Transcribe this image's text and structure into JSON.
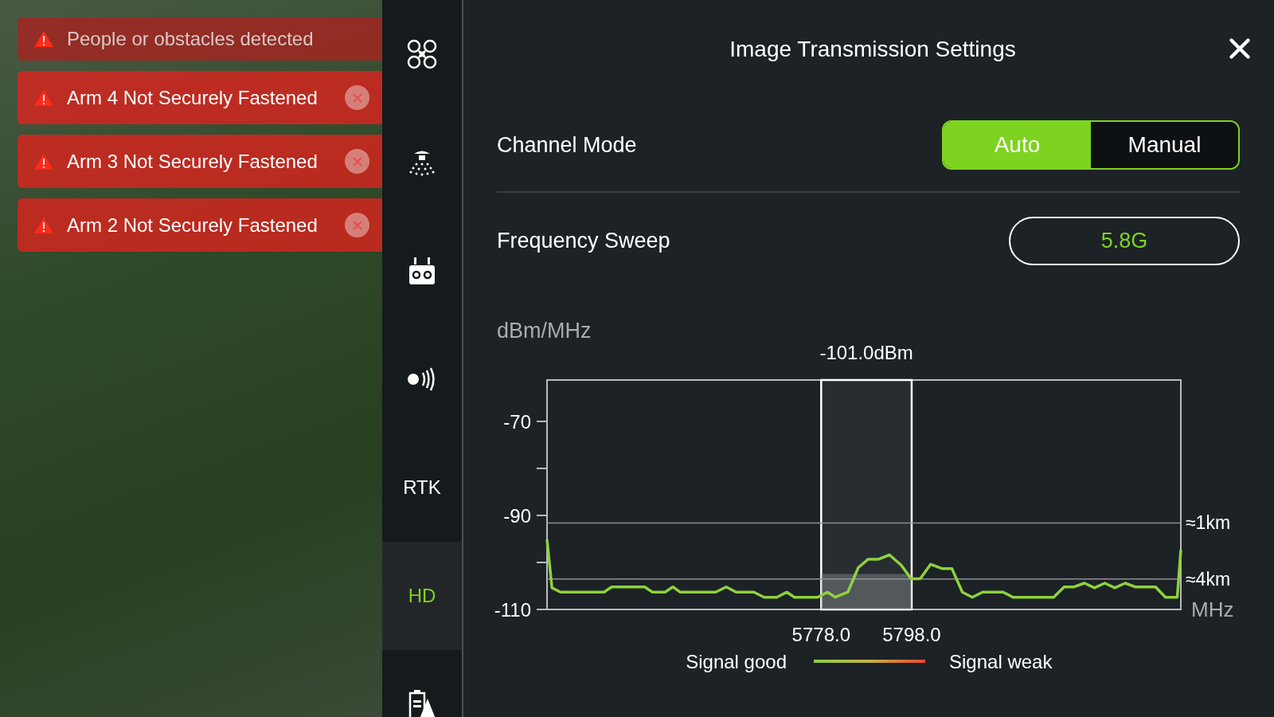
{
  "alerts": [
    {
      "text": "People or obstacles detected",
      "dimmed": true,
      "dismissible": false
    },
    {
      "text": "Arm 4 Not Securely Fastened",
      "dimmed": false,
      "dismissible": true
    },
    {
      "text": "Arm 3 Not Securely Fastened",
      "dimmed": false,
      "dismissible": true
    },
    {
      "text": "Arm 2 Not Securely Fastened",
      "dimmed": false,
      "dismissible": true
    }
  ],
  "sidebar": {
    "items": [
      {
        "kind": "drone",
        "selected": false
      },
      {
        "kind": "sprayer",
        "selected": false
      },
      {
        "kind": "remote",
        "selected": false
      },
      {
        "kind": "signal",
        "selected": false
      },
      {
        "kind": "text",
        "label": "RTK",
        "selected": false
      },
      {
        "kind": "text",
        "label": "HD",
        "selected": true
      },
      {
        "kind": "battery",
        "selected": false
      }
    ]
  },
  "panel": {
    "title": "Image Transmission Settings",
    "channel_mode": {
      "label": "Channel Mode",
      "options": [
        {
          "label": "Auto",
          "selected": true
        },
        {
          "label": "Manual",
          "selected": false
        }
      ]
    },
    "frequency_sweep": {
      "label": "Frequency Sweep",
      "value": "5.8G"
    },
    "chart_data": {
      "type": "line",
      "ylabel": "dBm/MHz",
      "xlabel": "MHz",
      "xlim": [
        5717.4,
        5857.5
      ],
      "ylim": [
        -110,
        -61.2
      ],
      "yticks": [
        -70,
        -90,
        -110
      ],
      "xticks": [
        {
          "value": 5778,
          "label": "5778.0"
        },
        {
          "value": 5798,
          "label": "5798.0"
        }
      ],
      "x": [
        5717.4,
        5718.5,
        5720.4,
        5730.0,
        5731.7,
        5739.0,
        5740.7,
        5743.5,
        5745.2,
        5746.8,
        5754.7,
        5757.0,
        5759.2,
        5763.1,
        5765.4,
        5768.2,
        5770.4,
        5772.1,
        5777.2,
        5779.4,
        5781.1,
        5783.9,
        5786.2,
        5788.4,
        5790.7,
        5793.1,
        5795.7,
        5797.9,
        5799.9,
        5802.2,
        5804.7,
        5806.9,
        5809.2,
        5811.4,
        5813.7,
        5818.2,
        5820.4,
        5829.4,
        5831.7,
        5833.9,
        5836.2,
        5838.4,
        5840.7,
        5842.9,
        5845.2,
        5847.4,
        5851.9,
        5854.1,
        5856.7,
        5857.5
      ],
      "series": [
        {
          "color": "#8fd13f",
          "values": [
            -95.1,
            -105.4,
            -106.3,
            -106.3,
            -105.2,
            -105.2,
            -106.3,
            -106.3,
            -105.2,
            -106.3,
            -106.3,
            -105.2,
            -106.3,
            -106.3,
            -107.4,
            -107.4,
            -106.3,
            -107.4,
            -107.4,
            -106.3,
            -107.4,
            -106.3,
            -101.1,
            -99.3,
            -99.3,
            -98.4,
            -100.6,
            -103.5,
            -103.5,
            -100.4,
            -101.3,
            -101.3,
            -106.3,
            -107.4,
            -106.3,
            -106.3,
            -107.4,
            -107.4,
            -105.2,
            -105.2,
            -104.4,
            -105.4,
            -104.4,
            -105.4,
            -104.4,
            -105.2,
            -105.2,
            -107.4,
            -107.4,
            -97.3
          ]
        }
      ],
      "bands": [
        {
          "axis": "x",
          "from": 5778,
          "to": 5798,
          "label": "-101.0dBm"
        }
      ],
      "ref_lines": [
        {
          "axis": "y",
          "value": -91.6,
          "label": "≈1km"
        },
        {
          "axis": "y",
          "value": -103.5,
          "label": "≈4km"
        }
      ]
    },
    "legend": {
      "good": "Signal good",
      "weak": "Signal weak"
    }
  }
}
